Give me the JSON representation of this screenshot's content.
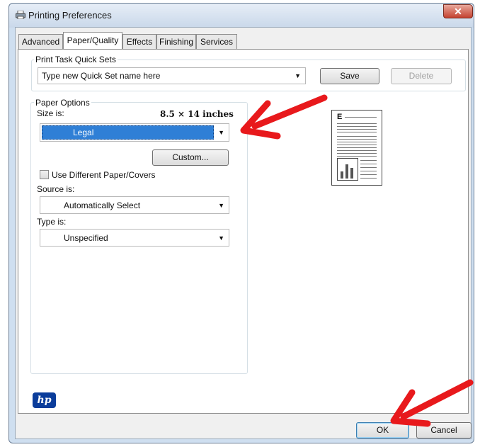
{
  "window": {
    "title": "Printing Preferences",
    "close_label": "✕"
  },
  "tabs": [
    {
      "label": "Advanced",
      "active": false
    },
    {
      "label": "Paper/Quality",
      "active": true
    },
    {
      "label": "Effects",
      "active": false
    },
    {
      "label": "Finishing",
      "active": false
    },
    {
      "label": "Services",
      "active": false
    }
  ],
  "quick_sets": {
    "group_label": "Print Task Quick Sets",
    "value": "Type new Quick Set name here",
    "save_label": "Save",
    "delete_label": "Delete"
  },
  "paper_options": {
    "group_label": "Paper Options",
    "size_label": "Size is:",
    "size_dimensions": "8.5 × 14 inches",
    "size_value": "Legal",
    "custom_label": "Custom...",
    "use_different_label": "Use Different Paper/Covers",
    "use_different_checked": false,
    "source_label": "Source is:",
    "source_value": "Automatically Select",
    "type_label": "Type is:",
    "type_value": "Unspecified"
  },
  "preview": {
    "heading_letter": "E"
  },
  "brand": {
    "logo_text": "hp"
  },
  "footer": {
    "ok_label": "OK",
    "cancel_label": "Cancel"
  },
  "annotations": {
    "arrow_color": "#e8191c"
  },
  "icons": [
    "printer-icon",
    "close-icon",
    "dropdown-arrow-icon",
    "hp-logo",
    "annotation-arrow"
  ]
}
